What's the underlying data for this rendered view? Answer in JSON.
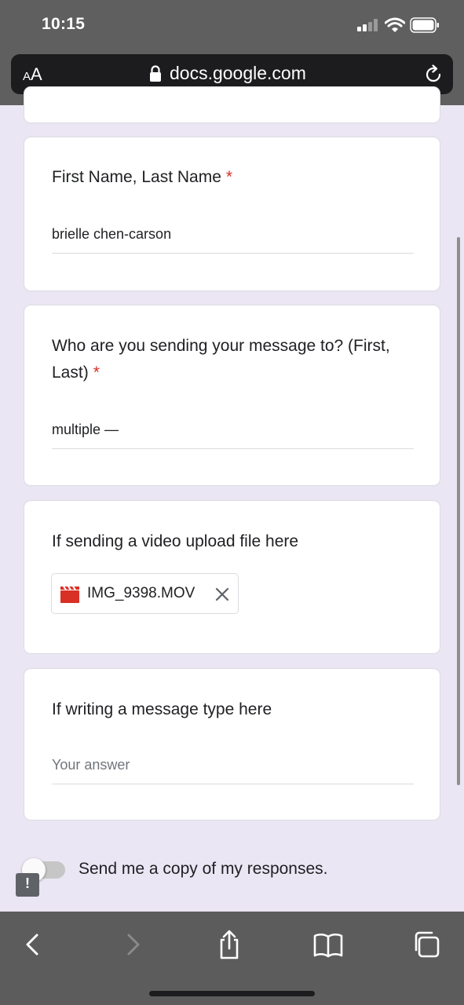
{
  "status_bar": {
    "time": "10:15"
  },
  "browser": {
    "text_size_label_small": "A",
    "text_size_label_large": "A",
    "url": "docs.google.com"
  },
  "form": {
    "questions": [
      {
        "title": "First Name, Last Name",
        "required_mark": "*",
        "answer": "brielle chen-carson"
      },
      {
        "title": "Who are you sending your message to? (First, Last)",
        "required_mark": "*",
        "answer": "multiple —"
      },
      {
        "title": "If sending a video upload file here",
        "file_name": "IMG_9398.MOV"
      },
      {
        "title": "If writing a message type here",
        "placeholder": "Your answer"
      }
    ],
    "send_copy_label": "Send me a copy of my responses.",
    "send_copy_enabled": false,
    "report_icon": "!"
  },
  "icons": {
    "lock": "lock-icon",
    "reload": "reload-icon",
    "film": "film-icon",
    "close": "close-icon",
    "back": "back-icon",
    "forward": "forward-icon",
    "share": "share-icon",
    "bookmarks": "bookmarks-icon",
    "tabs": "tabs-icon"
  },
  "colors": {
    "required": "#d93025",
    "film_icon": "#d93025",
    "page_background": "#ebe6f3"
  }
}
